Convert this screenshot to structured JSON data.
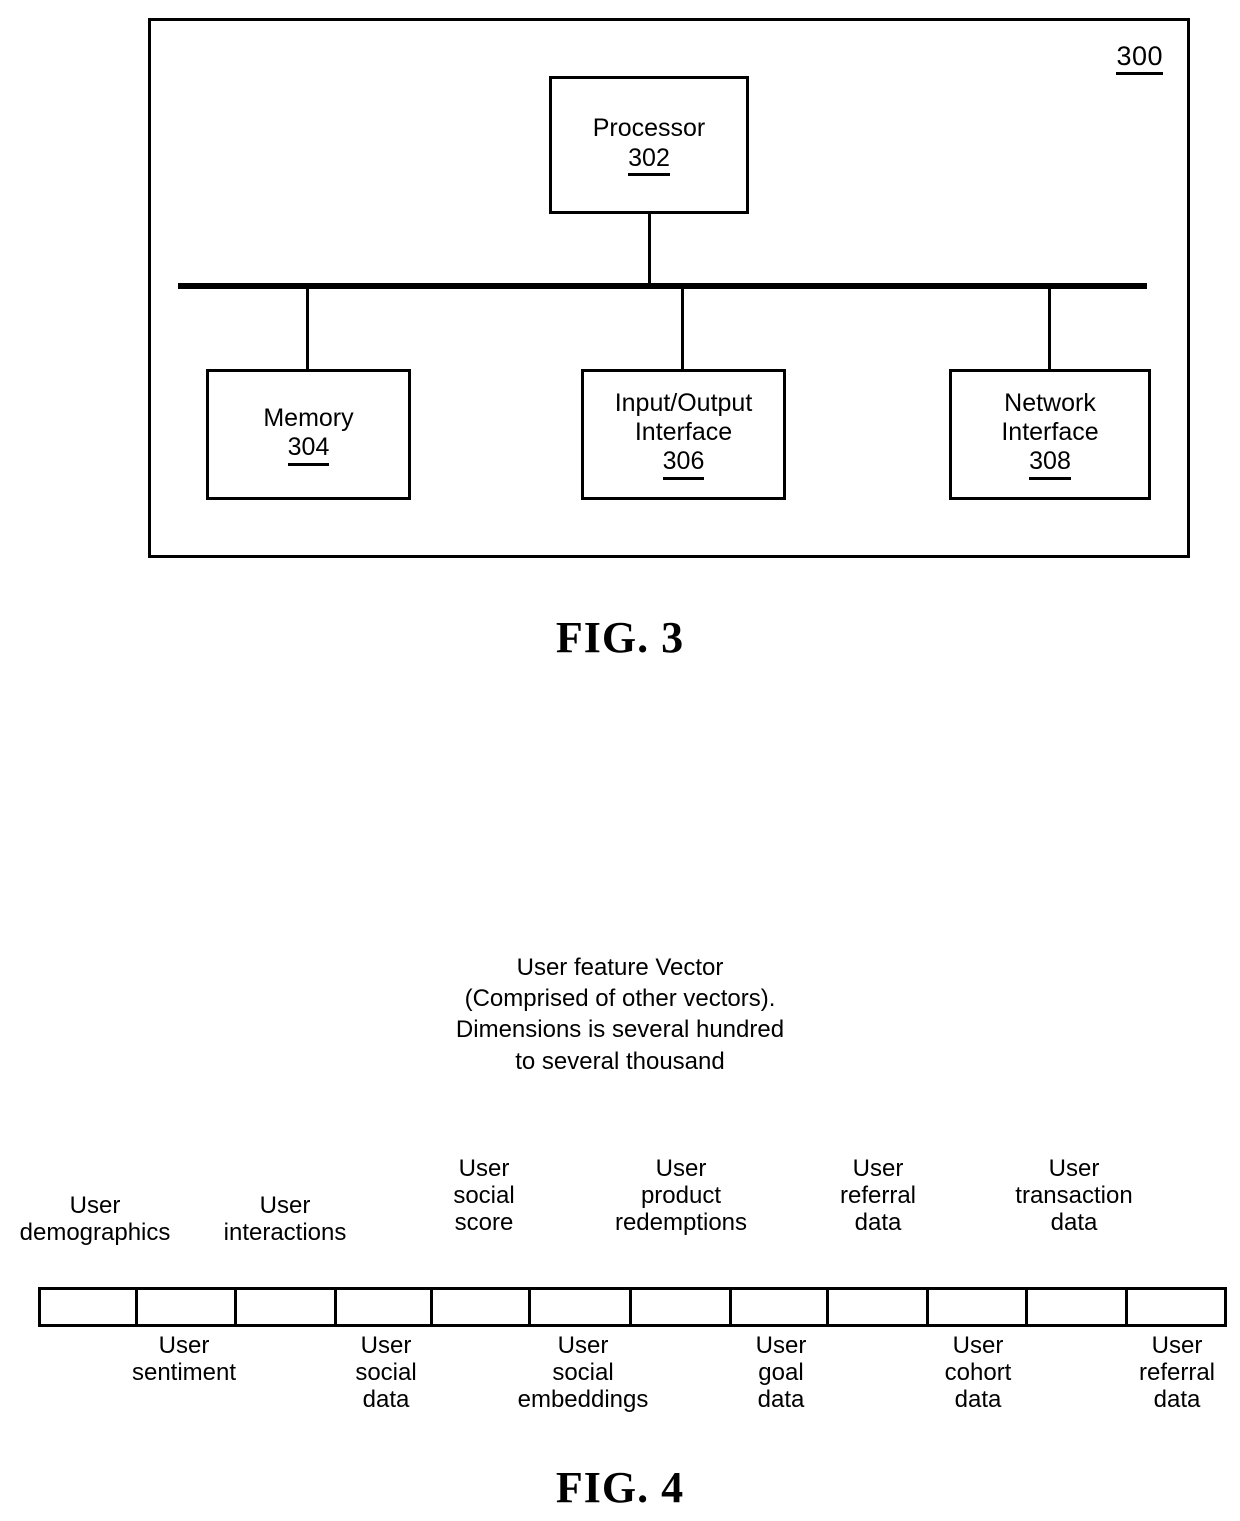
{
  "figure3": {
    "reference_number": "300",
    "caption": "FIG. 3",
    "boxes": [
      {
        "title": "Processor",
        "ref": "302"
      },
      {
        "title": "Memory",
        "ref": "304"
      },
      {
        "title": "Input/Output\nInterface",
        "ref": "306"
      },
      {
        "title": "Network\nInterface",
        "ref": "308"
      }
    ]
  },
  "figure4": {
    "caption": "FIG. 4",
    "title": "User feature Vector\n(Comprised of other vectors).\nDimensions is several hundred\nto several thousand",
    "cell_count": 12,
    "top_labels": [
      "User\ndemographics",
      "User\ninteractions",
      "User\nsocial\nscore",
      "User\nproduct\nredemptions",
      "User\nreferral\ndata",
      "User\ntransaction\ndata"
    ],
    "bottom_labels": [
      "User\nsentiment",
      "User\nsocial\ndata",
      "User\nsocial\nembeddings",
      "User\ngoal\ndata",
      "User\ncohort\ndata",
      "User\nreferral\ndata"
    ]
  },
  "colors": {
    "ink": "#000000",
    "paper": "#ffffff"
  }
}
